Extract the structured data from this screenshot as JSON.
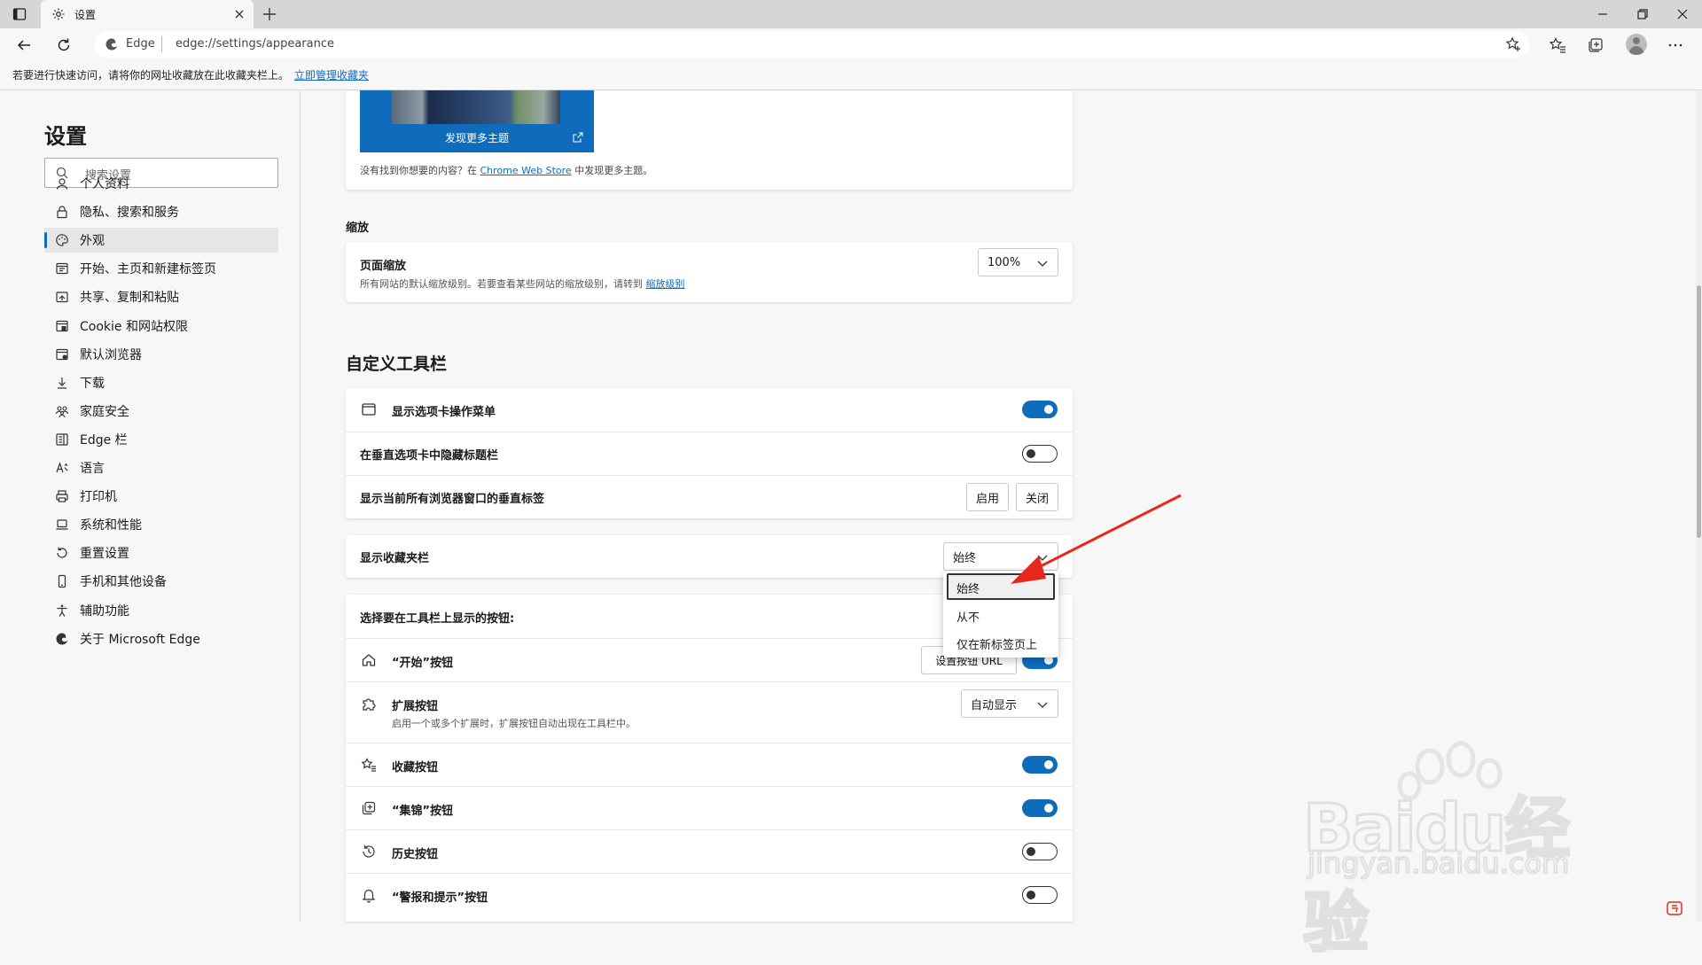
{
  "browser": {
    "tab_title": "设置",
    "site_name": "Edge",
    "url": "edge://settings/appearance",
    "favorites_hint": "若要进行快速访问，请将你的网址收藏放在此收藏夹栏上。",
    "favorites_hint_link": "立即管理收藏夹"
  },
  "sidebar": {
    "title": "设置",
    "search_placeholder": "搜索设置",
    "items": [
      {
        "label": "个人资料",
        "icon": "profile-icon"
      },
      {
        "label": "隐私、搜索和服务",
        "icon": "lock-icon"
      },
      {
        "label": "外观",
        "icon": "palette-icon",
        "active": true
      },
      {
        "label": "开始、主页和新建标签页",
        "icon": "home-page-icon"
      },
      {
        "label": "共享、复制和粘贴",
        "icon": "share-icon"
      },
      {
        "label": "Cookie 和网站权限",
        "icon": "site-permissions-icon"
      },
      {
        "label": "默认浏览器",
        "icon": "browser-icon"
      },
      {
        "label": "下载",
        "icon": "download-icon"
      },
      {
        "label": "家庭安全",
        "icon": "family-icon"
      },
      {
        "label": "Edge 栏",
        "icon": "edge-bar-icon"
      },
      {
        "label": "语言",
        "icon": "language-icon"
      },
      {
        "label": "打印机",
        "icon": "printer-icon"
      },
      {
        "label": "系统和性能",
        "icon": "laptop-icon"
      },
      {
        "label": "重置设置",
        "icon": "reset-icon"
      },
      {
        "label": "手机和其他设备",
        "icon": "phone-icon"
      },
      {
        "label": "辅助功能",
        "icon": "accessibility-icon"
      },
      {
        "label": "关于 Microsoft Edge",
        "icon": "edge-logo-icon"
      }
    ]
  },
  "themes": {
    "discover_label": "发现更多主题",
    "note_prefix": "没有找到你想要的内容？在",
    "note_link": "Chrome Web Store",
    "note_suffix": "中发现更多主题。"
  },
  "zoom": {
    "section_title": "缩放",
    "label": "页面缩放",
    "description": "所有网站的默认缩放级别。若要查看某些网站的缩放级别，请转到",
    "description_link": "缩放级别",
    "value": "100%"
  },
  "toolbar_section": {
    "title": "自定义工具栏",
    "show_tab_actions": {
      "label": "显示选项卡操作菜单",
      "on": true
    },
    "hide_title_bar": {
      "label": "在垂直选项卡中隐藏标题栏",
      "on": false
    },
    "vertical_tabs": {
      "label": "显示当前所有浏览器窗口的垂直标签",
      "enable": "启用",
      "disable": "关闭"
    },
    "favorites_bar": {
      "label": "显示收藏夹栏",
      "value": "始终"
    },
    "buttons_header": "选择要在工具栏上显示的按钮:",
    "home_button": {
      "label": "“开始”按钮",
      "set_url": "设置按钮 URL"
    },
    "extensions_button": {
      "label": "扩展按钮",
      "description": "启用一个或多个扩展时，扩展按钮自动出现在工具栏中。",
      "value": "自动显示"
    },
    "favorites_button": {
      "label": "收藏按钮",
      "on": true
    },
    "collections_button": {
      "label": "“集锦”按钮",
      "on": true
    },
    "history_button": {
      "label": "历史按钮",
      "on": false
    },
    "alerts_button": {
      "label": "“警报和提示”按钮",
      "on": false
    }
  },
  "dropdown": {
    "options": [
      "始终",
      "从不",
      "仅在新标签页上"
    ],
    "selected": "始终"
  },
  "watermark": {
    "logo": "Bai du 经验",
    "url": "jingyan.baidu.com"
  },
  "colors": {
    "accent": "#0f6cbd",
    "arrow": "#e8271c"
  }
}
